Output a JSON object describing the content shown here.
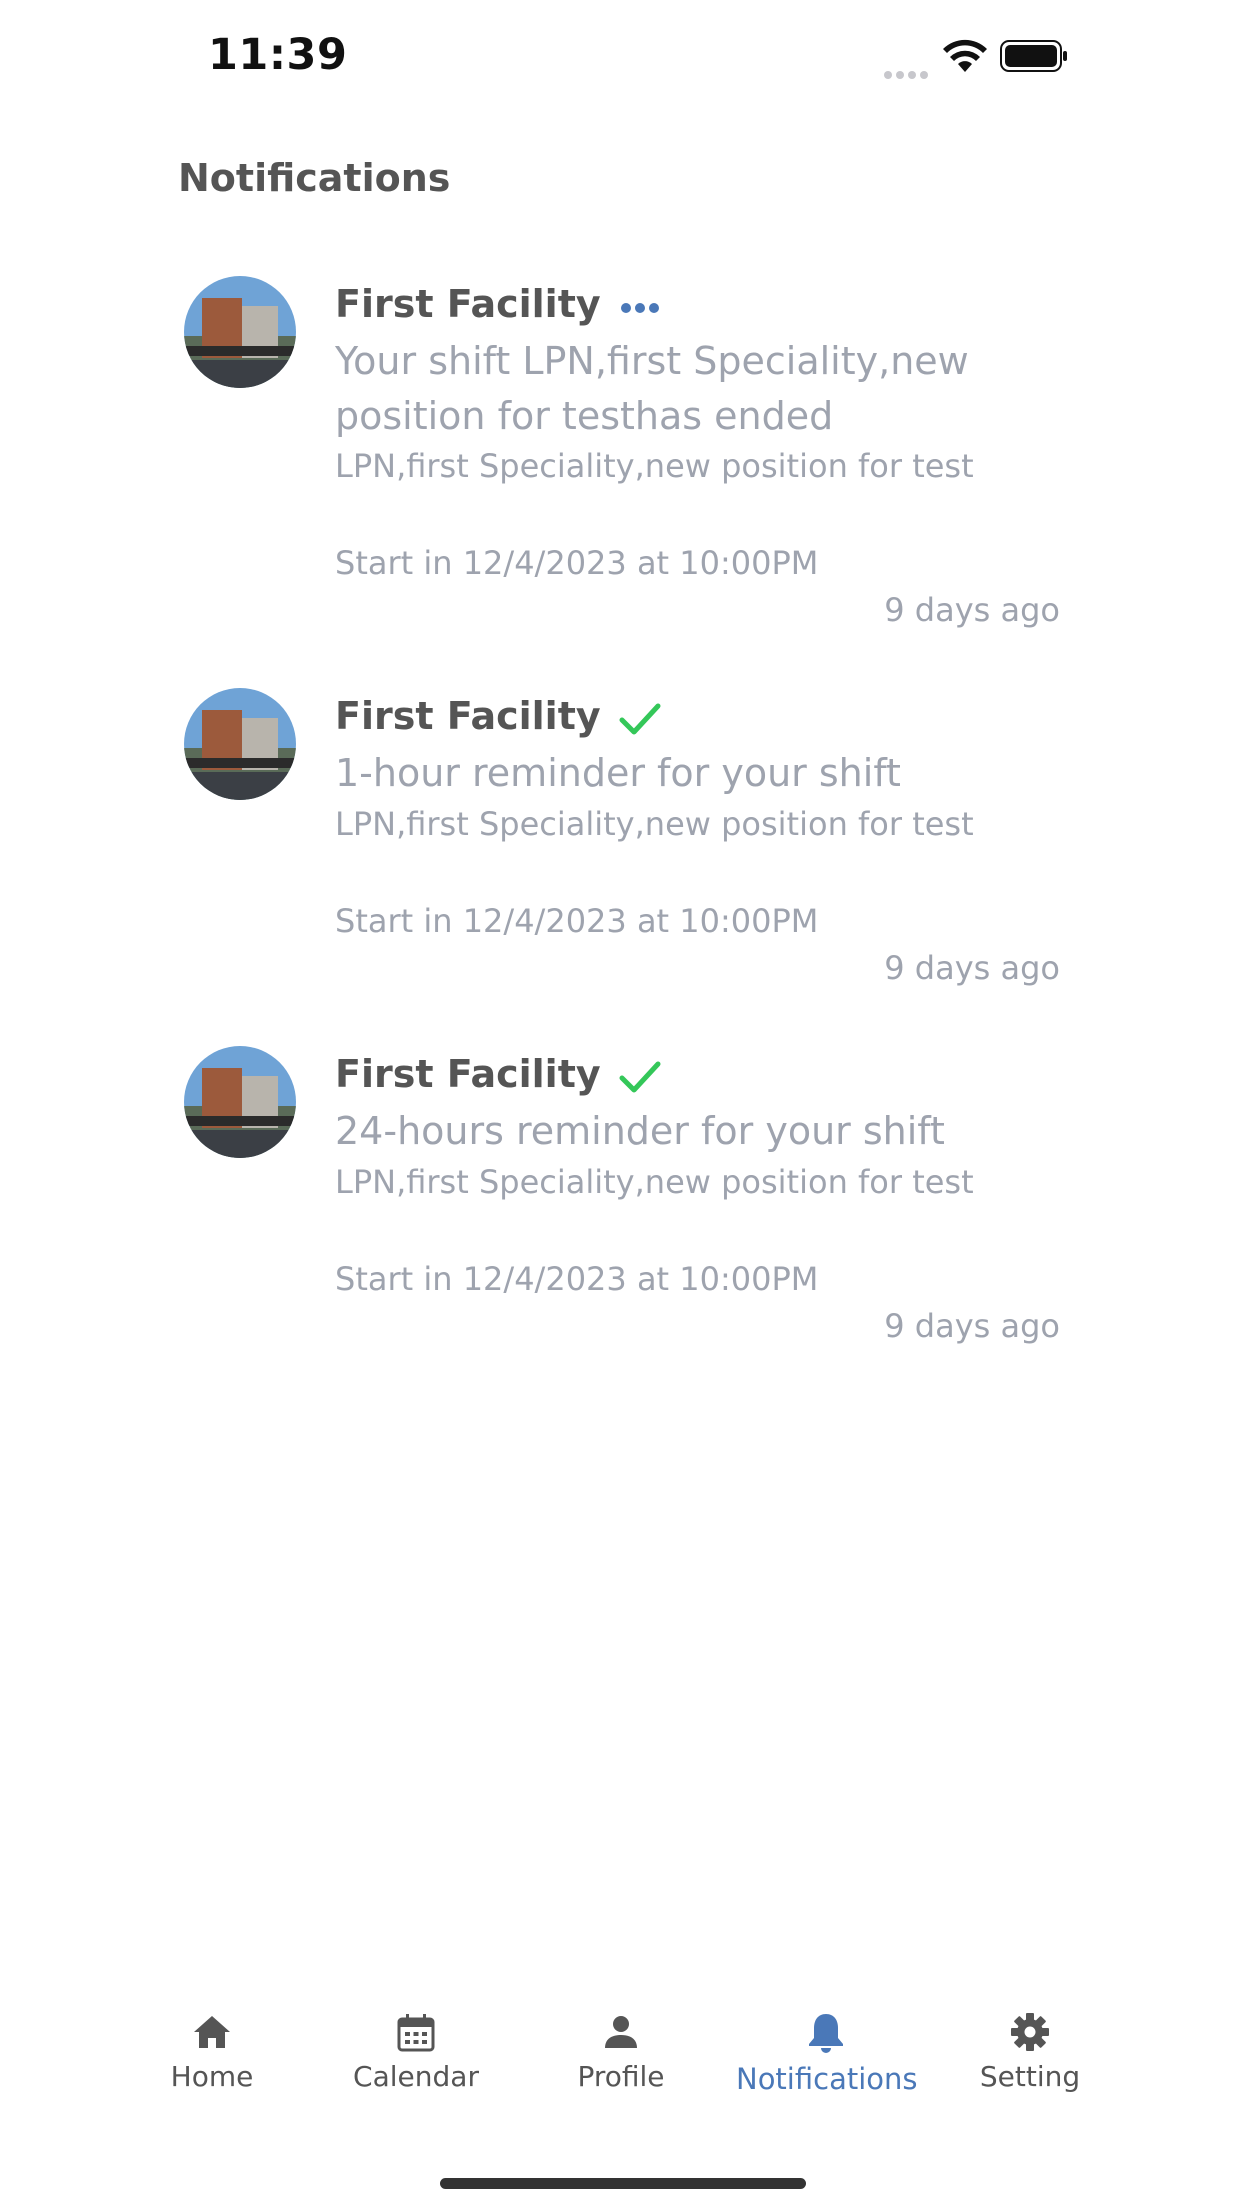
{
  "status_bar": {
    "time": "11:39"
  },
  "page_title": "Notifications",
  "notifications": [
    {
      "name": "First Facility",
      "status_icon": "more-dots-icon",
      "title": "Your shift LPN,first Speciality,new position for testhas ended",
      "detail": "LPN,first Speciality,new position for test",
      "start": "Start in 12/4/2023 at 10:00PM",
      "time_ago": "9 days ago"
    },
    {
      "name": "First Facility",
      "status_icon": "checkmark-icon",
      "title": "1-hour reminder for your shift",
      "detail": "LPN,first Speciality,new position for test",
      "start": "Start in 12/4/2023 at 10:00PM",
      "time_ago": "9 days ago"
    },
    {
      "name": "First Facility",
      "status_icon": "checkmark-icon",
      "title": "24-hours reminder for your shift",
      "detail": "LPN,first Speciality,new position for test",
      "start": "Start in 12/4/2023 at 10:00PM",
      "time_ago": "9 days ago"
    }
  ],
  "tabs": [
    {
      "label": "Home",
      "icon": "home-icon"
    },
    {
      "label": "Calendar",
      "icon": "calendar-icon"
    },
    {
      "label": "Profile",
      "icon": "person-icon"
    },
    {
      "label": "Notifications",
      "icon": "bell-icon",
      "active": true
    },
    {
      "label": "Setting",
      "icon": "gear-icon"
    }
  ],
  "colors": {
    "accent": "#4a78b8",
    "check": "#34c759",
    "text_dark": "#555555",
    "text_muted": "#9ea3ae"
  }
}
